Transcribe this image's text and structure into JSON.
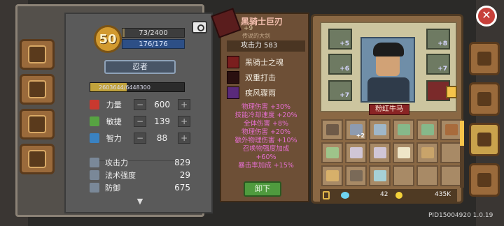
{
  "player": {
    "level": "50",
    "exp": "73/2400",
    "hp": "176/176",
    "class_name": "忍者",
    "gold_progress": "2603644/6448300"
  },
  "attributes": [
    {
      "label": "力量",
      "value": "600",
      "icon_color": "#c9392f"
    },
    {
      "label": "敏捷",
      "value": "139",
      "icon_color": "#57a342"
    },
    {
      "label": "智力",
      "value": "88",
      "icon_color": "#3a82c2"
    }
  ],
  "combat": [
    {
      "label": "攻击力",
      "value": "829"
    },
    {
      "label": "法术强度",
      "value": "29"
    },
    {
      "label": "防御",
      "value": "675"
    }
  ],
  "weapon": {
    "name": "黑骑士巨刃",
    "plus": "+9",
    "subtitle": "传说的大剑",
    "attack": "攻击力 583",
    "skills": [
      "黑骑士之魂",
      "双重打击",
      "疾风骤雨"
    ],
    "effects": [
      "物理伤害 +30%",
      "技能冷却速度 +20%",
      "全体伤害 +8%",
      "物理伤害 +20%",
      "额外物理伤害 +10%",
      "召唤物强度加成",
      "+60%",
      "暴击率加成 +15%"
    ],
    "unequip_label": "卸下"
  },
  "equipment_slots": [
    {
      "name": "helmet-slot",
      "count": "+5"
    },
    {
      "name": "amulet-slot",
      "count": "+6"
    },
    {
      "name": "armor-slot",
      "count": "+7"
    },
    {
      "name": "ring-slot",
      "count": "+8"
    },
    {
      "name": "boots-slot",
      "count": "+7"
    }
  ],
  "pet": {
    "name": "粉红牛马"
  },
  "inventory": [
    {
      "kind": "box",
      "color": "#6e5a48",
      "count": ""
    },
    {
      "kind": "bracelet",
      "color": "#8d9bb0",
      "count": "+2"
    },
    {
      "kind": "scroll",
      "color": "#9fb7c9",
      "count": ""
    },
    {
      "kind": "scroll",
      "color": "#86b88a",
      "count": ""
    },
    {
      "kind": "scroll",
      "color": "#86b88a",
      "count": ""
    },
    {
      "kind": "wood",
      "color": "#a86b3c",
      "count": ""
    },
    {
      "kind": "scroll",
      "color": "#9ec48a",
      "count": ""
    },
    {
      "kind": "bone",
      "color": "#d0c6d6",
      "count": ""
    },
    {
      "kind": "bone",
      "color": "#d0c6d6",
      "count": ""
    },
    {
      "kind": "feather",
      "color": "#efe6c8",
      "count": ""
    },
    {
      "kind": "feather",
      "color": "#c9a46a",
      "count": ""
    },
    {
      "kind": "empty",
      "color": "",
      "count": ""
    },
    {
      "kind": "wheat",
      "color": "#d7b06a",
      "count": ""
    },
    {
      "kind": "pouch",
      "color": "#7a6a58",
      "count": ""
    },
    {
      "kind": "card",
      "color": "#a6d0d6",
      "count": ""
    },
    {
      "kind": "empty",
      "color": "",
      "count": ""
    },
    {
      "kind": "empty",
      "color": "",
      "count": ""
    },
    {
      "kind": "empty",
      "color": "",
      "count": ""
    }
  ],
  "resources": {
    "gems": "42",
    "coins": "435K"
  },
  "footer": {
    "pid": "PID15004920 1.0.19"
  },
  "close_label": "✕"
}
